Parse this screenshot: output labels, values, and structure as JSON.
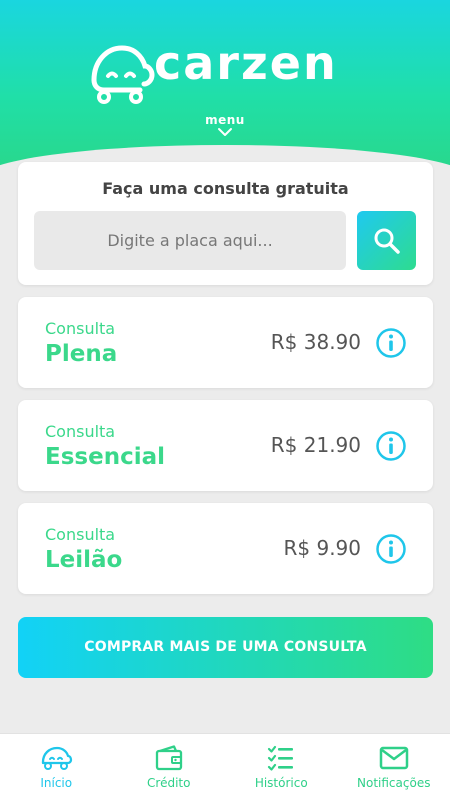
{
  "brand": {
    "name": "carzen"
  },
  "menu": {
    "label": "menu"
  },
  "search": {
    "title": "Faça uma consulta gratuita",
    "placeholder": "Digite a placa aqui..."
  },
  "offers": [
    {
      "label": "Consulta",
      "name": "Plena",
      "price": "R$ 38.90"
    },
    {
      "label": "Consulta",
      "name": "Essencial",
      "price": "R$ 21.90"
    },
    {
      "label": "Consulta",
      "name": "Leilão",
      "price": "R$ 9.90"
    }
  ],
  "buy_button": {
    "label": "COMPRAR MAIS DE UMA CONSULTA"
  },
  "tabs": [
    {
      "label": "Início",
      "icon": "car-icon",
      "active": true
    },
    {
      "label": "Crédito",
      "icon": "wallet-icon",
      "active": false
    },
    {
      "label": "Histórico",
      "icon": "checklist-icon",
      "active": false
    },
    {
      "label": "Notificações",
      "icon": "mail-icon",
      "active": false
    }
  ],
  "colors": {
    "accent_green": "#3bd88b",
    "accent_cyan": "#1fc6ea",
    "background": "#ececec"
  }
}
